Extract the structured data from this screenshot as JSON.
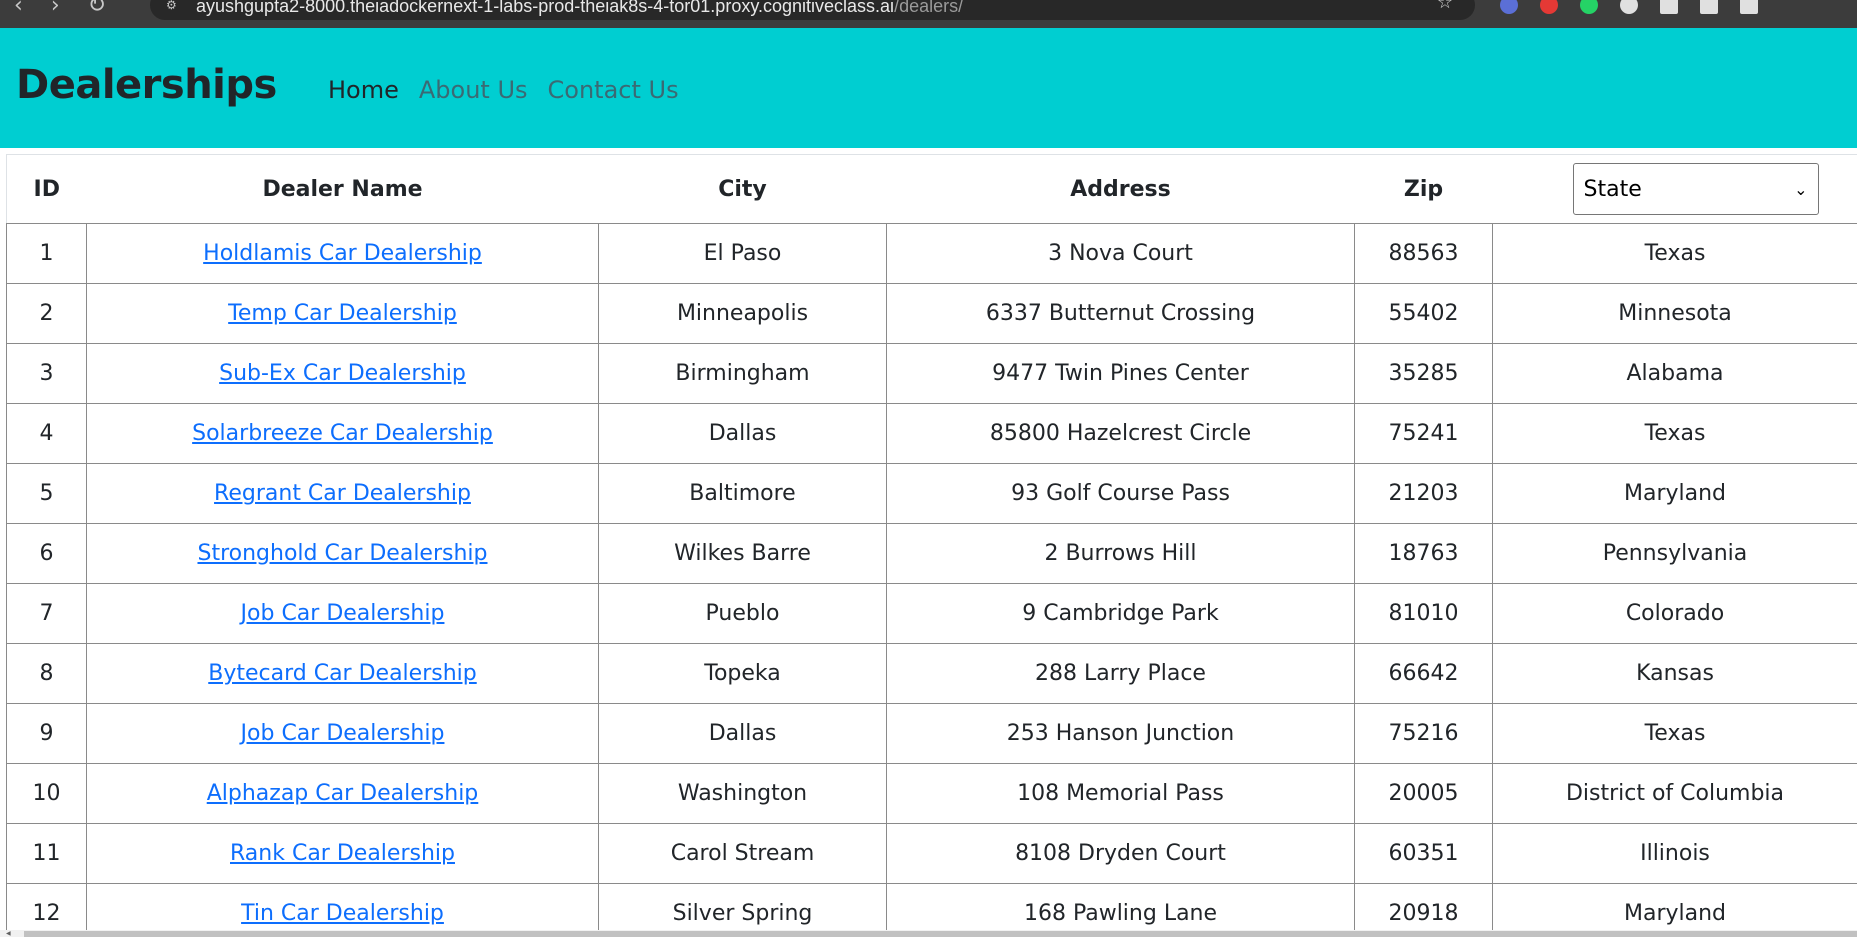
{
  "browser": {
    "url_host": "ayushgupta2-8000.theiadockernext-1-labs-prod-theiak8s-4-tor01.proxy.cognitiveclass.ai",
    "url_path": "/dealers/"
  },
  "navbar": {
    "brand": "Dealerships",
    "links": [
      "Home",
      "About Us",
      "Contact Us"
    ]
  },
  "table": {
    "headers": [
      "ID",
      "Dealer Name",
      "City",
      "Address",
      "Zip"
    ],
    "state_select": {
      "selected": "State"
    },
    "rows": [
      [
        "1",
        "Holdlamis Car Dealership",
        "El Paso",
        "3 Nova Court",
        "88563",
        "Texas"
      ],
      [
        "2",
        "Temp Car Dealership",
        "Minneapolis",
        "6337 Butternut Crossing",
        "55402",
        "Minnesota"
      ],
      [
        "3",
        "Sub-Ex Car Dealership",
        "Birmingham",
        "9477 Twin Pines Center",
        "35285",
        "Alabama"
      ],
      [
        "4",
        "Solarbreeze Car Dealership",
        "Dallas",
        "85800 Hazelcrest Circle",
        "75241",
        "Texas"
      ],
      [
        "5",
        "Regrant Car Dealership",
        "Baltimore",
        "93 Golf Course Pass",
        "21203",
        "Maryland"
      ],
      [
        "6",
        "Stronghold Car Dealership",
        "Wilkes Barre",
        "2 Burrows Hill",
        "18763",
        "Pennsylvania"
      ],
      [
        "7",
        "Job Car Dealership",
        "Pueblo",
        "9 Cambridge Park",
        "81010",
        "Colorado"
      ],
      [
        "8",
        "Bytecard Car Dealership",
        "Topeka",
        "288 Larry Place",
        "66642",
        "Kansas"
      ],
      [
        "9",
        "Job Car Dealership",
        "Dallas",
        "253 Hanson Junction",
        "75216",
        "Texas"
      ],
      [
        "10",
        "Alphazap Car Dealership",
        "Washington",
        "108 Memorial Pass",
        "20005",
        "District of Columbia"
      ],
      [
        "11",
        "Rank Car Dealership",
        "Carol Stream",
        "8108 Dryden Court",
        "60351",
        "Illinois"
      ],
      [
        "12",
        "Tin Car Dealership",
        "Silver Spring",
        "168 Pawling Lane",
        "20918",
        "Maryland"
      ]
    ]
  },
  "colors": {
    "navbar_bg": "#00ced1",
    "link": "#0d6efd"
  }
}
